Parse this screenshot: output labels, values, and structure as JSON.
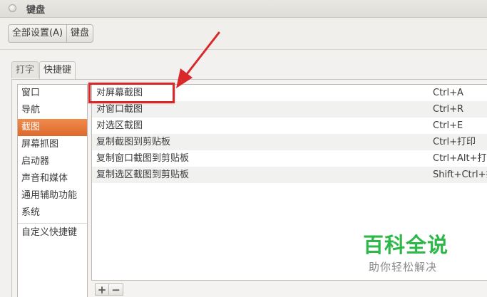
{
  "window": {
    "title": "键盘"
  },
  "toolbar": {
    "all_settings": "全部设置(A)",
    "current": "键盘"
  },
  "tabs": [
    {
      "label": "打字",
      "active": false
    },
    {
      "label": "快捷键",
      "active": true
    }
  ],
  "categories": {
    "items": [
      "窗口",
      "导航",
      "截图",
      "屏幕抓图",
      "启动器",
      "声音和媒体",
      "通用辅助功能",
      "系统"
    ],
    "selected": "截图",
    "custom": "自定义快捷键"
  },
  "shortcuts": [
    {
      "name": "对屏幕截图",
      "key": "Ctrl+A"
    },
    {
      "name": "对窗口截图",
      "key": "Ctrl+R"
    },
    {
      "name": "对选区截图",
      "key": "Ctrl+E"
    },
    {
      "name": "复制截图到剪贴板",
      "key": "Ctrl+打印"
    },
    {
      "name": "复制窗口截图到剪贴板",
      "key": "Ctrl+Alt+打"
    },
    {
      "name": "复制选区截图到剪贴板",
      "key": "Shift+Ctrl+打"
    }
  ],
  "buttons": {
    "add": "+",
    "remove": "−"
  },
  "watermark": {
    "title": "百科全说",
    "subtitle": "助你轻松解决"
  },
  "colors": {
    "selected": "#e7753a",
    "annotation": "#d8282a",
    "watermark": "#2fb84a"
  }
}
